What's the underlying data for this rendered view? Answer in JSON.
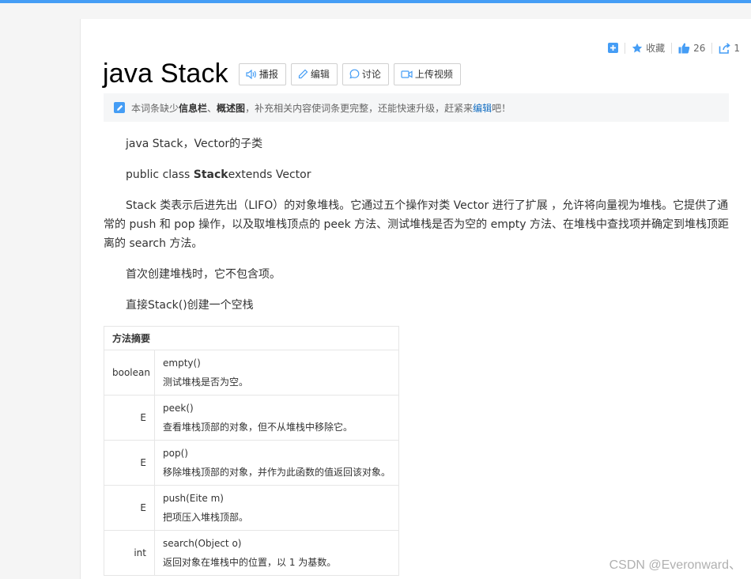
{
  "title": "java Stack",
  "toolbar": {
    "buttons": [
      {
        "label": "播报",
        "icon": "speaker-icon"
      },
      {
        "label": "编辑",
        "icon": "pencil-icon"
      },
      {
        "label": "讨论",
        "icon": "chat-icon"
      },
      {
        "label": "上传视频",
        "icon": "video-icon"
      }
    ]
  },
  "actions": {
    "collect": "收藏",
    "likes": "26",
    "shares": "1"
  },
  "notice": {
    "pre": "本词条缺少",
    "bold1": "信息栏",
    "sep": "、",
    "bold2": "概述图",
    "mid": "，补充相关内容使词条更完整，还能快速升级，赶紧来",
    "link": "编辑",
    "post": "吧！"
  },
  "content": {
    "p1": "java Stack，Vector的子类",
    "p2_pre": "public class ",
    "p2_bold": "Stack",
    "p2_post": "extends Vector",
    "p3": "Stack 类表示后进先出（LIFO）的对象堆栈。它通过五个操作对类 Vector 进行了扩展 ，允许将向量视为堆栈。它提供了通常的 push 和 pop 操作，以及取堆栈顶点的 peek 方法、测试堆栈是否为空的 empty 方法、在堆栈中查找项并确定到堆栈顶距离的 search 方法。",
    "p4": "首次创建堆栈时，它不包含项。",
    "p5": "直接Stack()创建一个空栈"
  },
  "methods": {
    "header": "方法摘要",
    "rows": [
      {
        "type": "boolean",
        "name": "empty()",
        "desc": "测试堆栈是否为空。"
      },
      {
        "type": "E",
        "name": "peek()",
        "desc": "查看堆栈顶部的对象，但不从堆栈中移除它。"
      },
      {
        "type": "E",
        "name": "pop()",
        "desc": "移除堆栈顶部的对象，并作为此函数的值返回该对象。"
      },
      {
        "type": "E",
        "name": "push(Eite m)",
        "desc": "把项压入堆栈顶部。"
      },
      {
        "type": "int",
        "name": "search(Object o)",
        "desc": "返回对象在堆栈中的位置，以 1 为基数。"
      }
    ]
  },
  "watermark": "CSDN @Everonward、",
  "colors": {
    "accent": "#459df5",
    "link": "#136ec2"
  }
}
